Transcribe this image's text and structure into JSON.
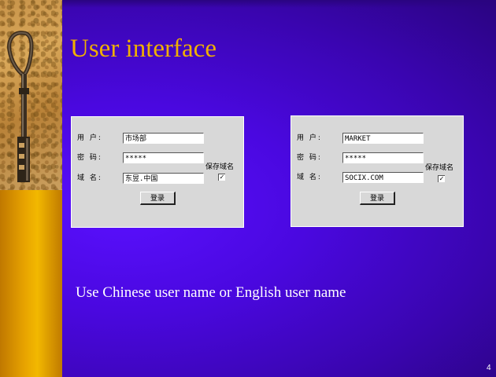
{
  "slide": {
    "title": "User interface",
    "caption": "Use Chinese user name or English user name",
    "page_number": "4"
  },
  "dialogs": [
    {
      "user_label": "用 户:",
      "user_value": "市场部",
      "password_label": "密 码:",
      "password_value": "*****",
      "domain_label": "域 名:",
      "domain_value": "东昱.中国",
      "side_label": "保存域名",
      "checkbox_mark": "✓",
      "login_label": "登录"
    },
    {
      "user_label": "用 户:",
      "user_value": "MARKET",
      "password_label": "密 码:",
      "password_value": "*****",
      "domain_label": "域 名:",
      "domain_value": "SOCIX.COM",
      "side_label": "保存域名",
      "checkbox_mark": "✓",
      "login_label": "登录"
    }
  ],
  "colors": {
    "title": "#f0b000",
    "background": "#4a08e0",
    "left_strip": "#e8a400"
  },
  "icons": [
    "key-photo-icon",
    "checkmark-icon"
  ]
}
